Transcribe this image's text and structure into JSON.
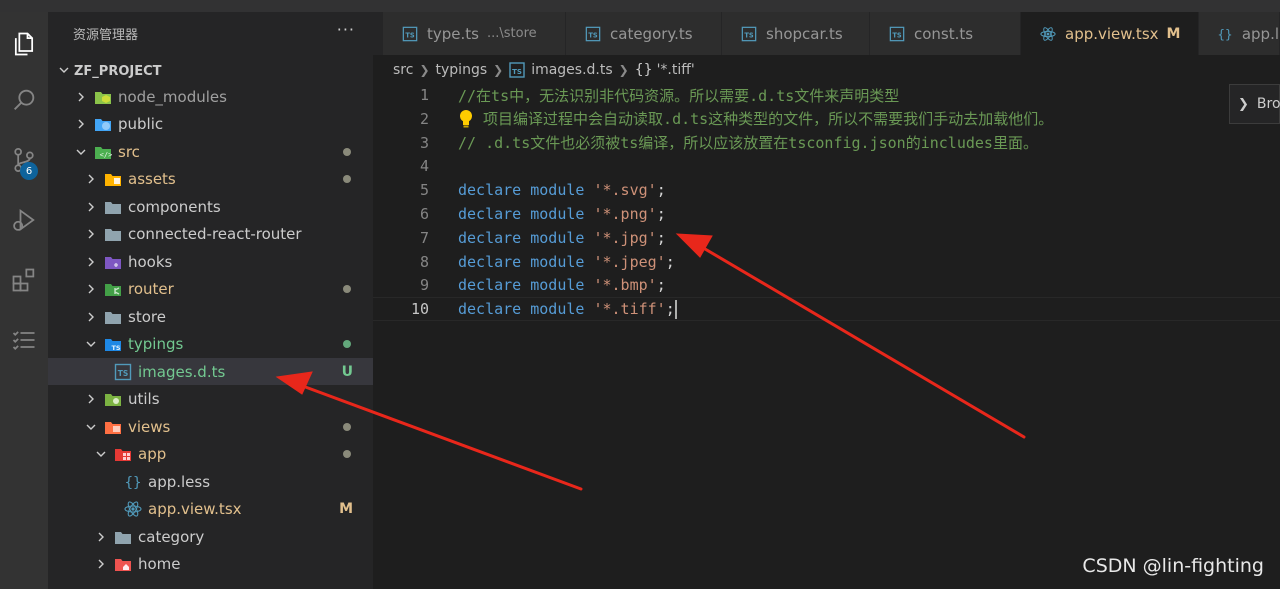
{
  "colors": {
    "activity_bar": "#333333",
    "sidebar": "#252526",
    "editor": "#1e1e1e",
    "comment": "#6a9955",
    "keyword": "#569cd6",
    "string": "#ce9178",
    "modified": "#e2c08d",
    "untracked": "#73c991",
    "badge": "#0e639c",
    "annotation_arrow": "#e8271b"
  },
  "activity_bar": {
    "items": [
      {
        "name": "explorer",
        "icon": "files-icon"
      },
      {
        "name": "search",
        "icon": "search-icon"
      },
      {
        "name": "source-control",
        "icon": "source-control-icon",
        "badge": "6"
      },
      {
        "name": "run-debug",
        "icon": "run-debug-icon"
      },
      {
        "name": "extensions",
        "icon": "extensions-icon"
      },
      {
        "name": "list",
        "icon": "list-icon"
      }
    ]
  },
  "sidebar": {
    "title": "资源管理器",
    "more": "···",
    "project": "ZF_PROJECT",
    "tree": [
      {
        "label": "node_modules",
        "icon": "node-folder-icon",
        "expanded": false,
        "depth": 0
      },
      {
        "label": "public",
        "icon": "public-folder-icon",
        "expanded": false,
        "depth": 0
      },
      {
        "label": "src",
        "icon": "src-folder-icon",
        "expanded": true,
        "depth": 0,
        "dot": true
      },
      {
        "label": "assets",
        "icon": "assets-folder-icon",
        "expanded": false,
        "depth": 1,
        "dot": true
      },
      {
        "label": "components",
        "icon": "folder-icon",
        "expanded": false,
        "depth": 1
      },
      {
        "label": "connected-react-router",
        "icon": "folder-icon",
        "expanded": false,
        "depth": 1
      },
      {
        "label": "hooks",
        "icon": "hooks-folder-icon",
        "expanded": false,
        "depth": 1
      },
      {
        "label": "router",
        "icon": "router-folder-icon",
        "expanded": false,
        "depth": 1,
        "dot": true
      },
      {
        "label": "store",
        "icon": "folder-icon",
        "expanded": false,
        "depth": 1
      },
      {
        "label": "typings",
        "icon": "ts-folder-icon",
        "expanded": true,
        "depth": 1,
        "dot": true
      },
      {
        "label": "images.d.ts",
        "icon": "ts-file-icon",
        "depth": 2,
        "status": "U",
        "selected": true
      },
      {
        "label": "utils",
        "icon": "utils-folder-icon",
        "expanded": false,
        "depth": 1
      },
      {
        "label": "views",
        "icon": "views-folder-icon",
        "expanded": true,
        "depth": 1,
        "dot": true
      },
      {
        "label": "app",
        "icon": "app-folder-icon",
        "expanded": true,
        "depth": 2,
        "dot": true
      },
      {
        "label": "app.less",
        "icon": "braces-icon",
        "depth": 3
      },
      {
        "label": "app.view.tsx",
        "icon": "react-icon",
        "depth": 3,
        "status": "M"
      },
      {
        "label": "category",
        "icon": "folder-icon",
        "expanded": false,
        "depth": 2
      },
      {
        "label": "home",
        "icon": "home-folder-icon",
        "expanded": false,
        "depth": 2
      }
    ]
  },
  "tabs": [
    {
      "label": "type.ts",
      "sub": "...\\store",
      "icon": "ts-file-icon"
    },
    {
      "label": "category.ts",
      "icon": "ts-file-icon"
    },
    {
      "label": "shopcar.ts",
      "icon": "ts-file-icon"
    },
    {
      "label": "const.ts",
      "icon": "ts-file-icon"
    },
    {
      "label": "app.view.tsx",
      "icon": "react-icon",
      "active": true,
      "status": "M"
    },
    {
      "label": "app.l",
      "icon": "braces-icon"
    }
  ],
  "breadcrumb": {
    "parts": [
      "src",
      "typings",
      "images.d.ts"
    ],
    "symbol": "'*.tiff'",
    "symbol_icon": "{}"
  },
  "editor": {
    "current_line": 10,
    "lines": [
      {
        "n": "1",
        "tokens": [
          {
            "t": "cm",
            "v": "//在ts中，无法识别非代码资源。所以需要.d.ts文件来声明类型"
          }
        ]
      },
      {
        "n": "2",
        "tokens": [
          {
            "t": "cm",
            "v": " 项目编译过程中会自动读取.d.ts这种类型的文件，所以不需要我们手动去加载他们。"
          }
        ],
        "bulb": true
      },
      {
        "n": "3",
        "tokens": [
          {
            "t": "cm",
            "v": "// .d.ts文件也必须被ts编译，所以应该放置在tsconfig.json的includes里面。"
          }
        ]
      },
      {
        "n": "4",
        "tokens": []
      },
      {
        "n": "5",
        "tokens": [
          {
            "t": "kw",
            "v": "declare"
          },
          {
            "t": "pn",
            "v": " "
          },
          {
            "t": "kw",
            "v": "module"
          },
          {
            "t": "pn",
            "v": " "
          },
          {
            "t": "str",
            "v": "'*.svg'"
          },
          {
            "t": "pn",
            "v": ";"
          }
        ]
      },
      {
        "n": "6",
        "tokens": [
          {
            "t": "kw",
            "v": "declare"
          },
          {
            "t": "pn",
            "v": " "
          },
          {
            "t": "kw",
            "v": "module"
          },
          {
            "t": "pn",
            "v": " "
          },
          {
            "t": "str",
            "v": "'*.png'"
          },
          {
            "t": "pn",
            "v": ";"
          }
        ]
      },
      {
        "n": "7",
        "tokens": [
          {
            "t": "kw",
            "v": "declare"
          },
          {
            "t": "pn",
            "v": " "
          },
          {
            "t": "kw",
            "v": "module"
          },
          {
            "t": "pn",
            "v": " "
          },
          {
            "t": "str",
            "v": "'*.jpg'"
          },
          {
            "t": "pn",
            "v": ";"
          }
        ]
      },
      {
        "n": "8",
        "tokens": [
          {
            "t": "kw",
            "v": "declare"
          },
          {
            "t": "pn",
            "v": " "
          },
          {
            "t": "kw",
            "v": "module"
          },
          {
            "t": "pn",
            "v": " "
          },
          {
            "t": "str",
            "v": "'*.jpeg'"
          },
          {
            "t": "pn",
            "v": ";"
          }
        ]
      },
      {
        "n": "9",
        "tokens": [
          {
            "t": "kw",
            "v": "declare"
          },
          {
            "t": "pn",
            "v": " "
          },
          {
            "t": "kw",
            "v": "module"
          },
          {
            "t": "pn",
            "v": " "
          },
          {
            "t": "str",
            "v": "'*.bmp'"
          },
          {
            "t": "pn",
            "v": ";"
          }
        ]
      },
      {
        "n": "10",
        "tokens": [
          {
            "t": "kw",
            "v": "declare"
          },
          {
            "t": "pn",
            "v": " "
          },
          {
            "t": "kw",
            "v": "module"
          },
          {
            "t": "pn",
            "v": " "
          },
          {
            "t": "str",
            "v": "'*.tiff'"
          },
          {
            "t": "pn",
            "v": ";"
          }
        ]
      }
    ]
  },
  "right_panel": {
    "label": "Bro",
    "icon": "chevron-right-icon"
  },
  "watermark": "CSDN @lin-fighting"
}
